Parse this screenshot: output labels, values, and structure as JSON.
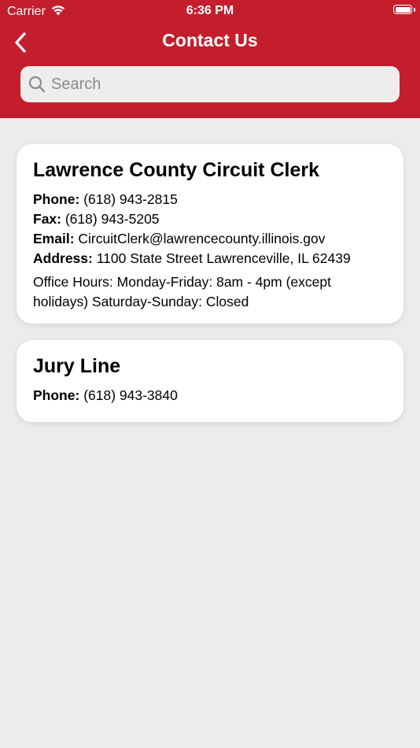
{
  "status_bar": {
    "carrier": "Carrier",
    "time": "6:36 PM",
    "battery_level": 1.0
  },
  "nav": {
    "title": "Contact Us",
    "back_icon": "chevron-left-icon"
  },
  "search": {
    "placeholder": "Search",
    "value": ""
  },
  "colors": {
    "brand_red": "#c41e2d",
    "background": "#ececec",
    "card": "#ffffff"
  },
  "contacts": [
    {
      "title": "Lawrence County Circuit Clerk",
      "phone_label": "Phone:",
      "phone": "(618) 943-2815",
      "fax_label": "Fax:",
      "fax": "(618) 943-5205",
      "email_label": "Email:",
      "email": "CircuitClerk@lawrencecounty.illinois.gov",
      "address_label": "Address:",
      "address": "1100 State Street Lawrenceville, IL 62439",
      "hours": "Office Hours: Monday-Friday: 8am - 4pm (except holidays)  Saturday-Sunday: Closed"
    },
    {
      "title": "Jury Line",
      "phone_label": "Phone:",
      "phone": "(618) 943-3840"
    }
  ]
}
